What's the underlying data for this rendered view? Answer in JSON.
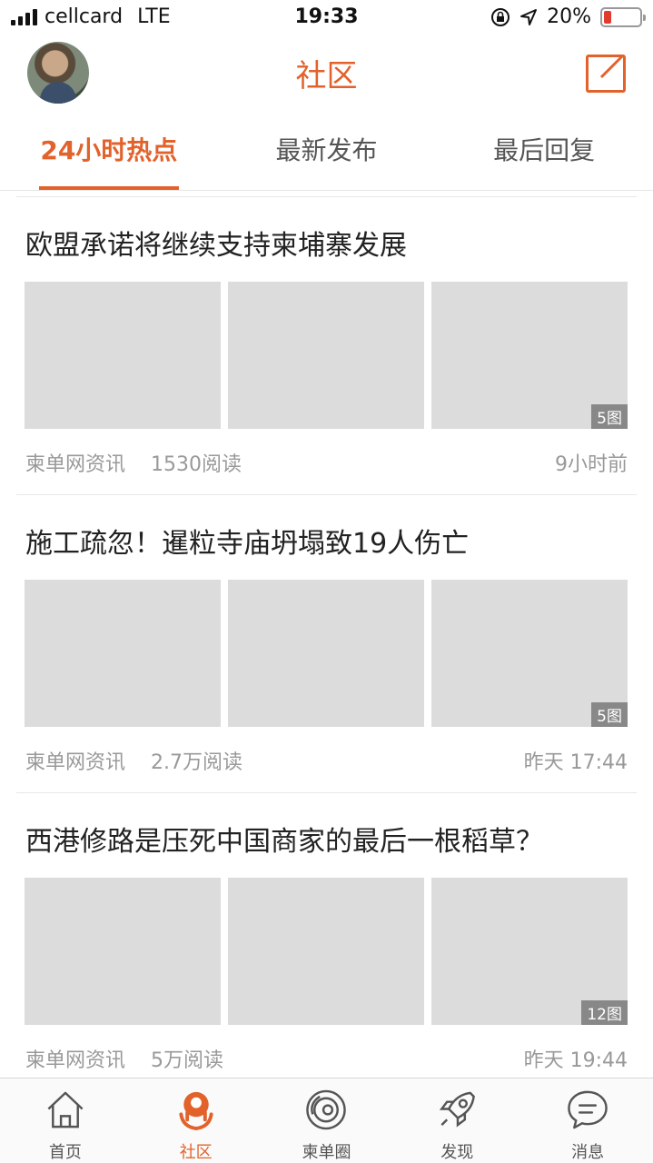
{
  "status_bar": {
    "carrier": "cellcard",
    "network": "LTE",
    "time": "19:33",
    "battery": "20%",
    "battery_level": 0.2
  },
  "header": {
    "title": "社区"
  },
  "tabs": [
    {
      "label": "24小时热点",
      "active": true
    },
    {
      "label": "最新发布",
      "active": false
    },
    {
      "label": "最后回复",
      "active": false
    }
  ],
  "articles": [
    {
      "title": "欧盟承诺将继续支持柬埔寨发展",
      "image_count": "5图",
      "source": "柬单网资讯",
      "reads": "1530阅读",
      "time": "9小时前"
    },
    {
      "title": "施工疏忽！暹粒寺庙坍塌致19人伤亡",
      "image_count": "5图",
      "source": "柬单网资讯",
      "reads": "2.7万阅读",
      "time": "昨天 17:44"
    },
    {
      "title": "西港修路是压死中国商家的最后一根稻草？",
      "image_count": "12图",
      "source": "柬单网资讯",
      "reads": "5万阅读",
      "time": "昨天 19:44"
    }
  ],
  "tab_bar": [
    {
      "label": "首页",
      "icon": "home-icon",
      "active": false
    },
    {
      "label": "社区",
      "icon": "community-icon",
      "active": true
    },
    {
      "label": "柬单圈",
      "icon": "circle-icon",
      "active": false
    },
    {
      "label": "发现",
      "icon": "rocket-icon",
      "active": false
    },
    {
      "label": "消息",
      "icon": "message-icon",
      "active": false
    }
  ],
  "colors": {
    "accent": "#e2622c",
    "placeholder": "#dcdcdc",
    "meta_text": "#999999"
  }
}
